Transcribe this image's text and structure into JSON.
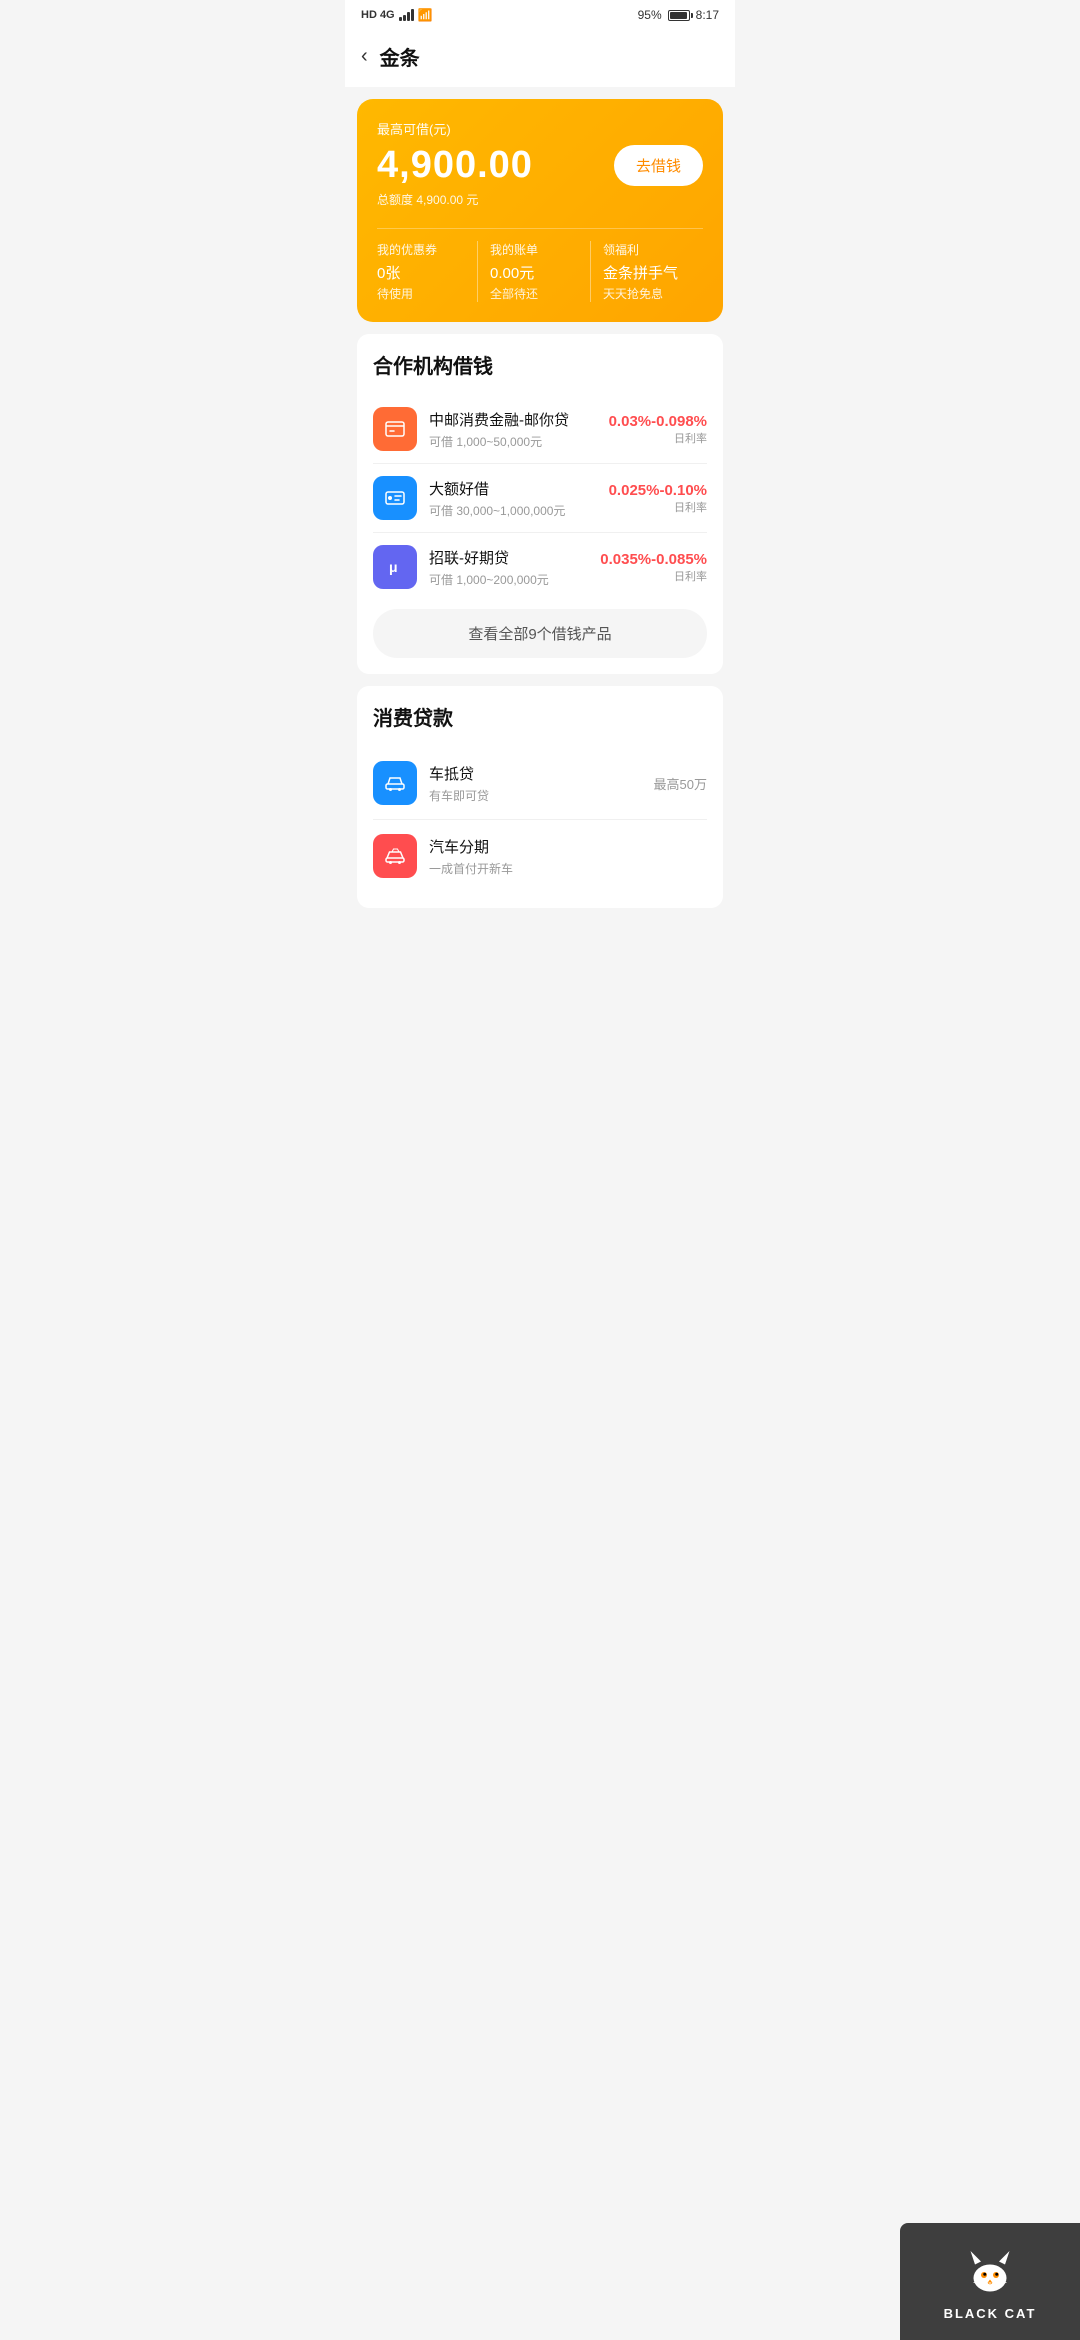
{
  "statusBar": {
    "networkType": "HD 4G",
    "batteryPercent": "95%",
    "time": "8:17"
  },
  "header": {
    "backLabel": "‹",
    "title": "金条"
  },
  "heroCard": {
    "label": "最高可借(元)",
    "amount": "4,900.00",
    "borrowBtnLabel": "去借钱",
    "subLabel": "总额度 4,900.00 元",
    "stats": [
      {
        "title": "我的优惠券",
        "value": "0张",
        "sub": "待使用"
      },
      {
        "title": "我的账单",
        "value": "0.00元",
        "sub": "全部待还"
      },
      {
        "title": "领福利",
        "value": "金条拼手气",
        "sub": "天天抢免息"
      }
    ]
  },
  "partnerSection": {
    "title": "合作机构借钱",
    "loans": [
      {
        "name": "中邮消费金融-邮你贷",
        "range": "可借 1,000~50,000元",
        "rate": "0.03%-0.098%",
        "rateLabel": "日利率",
        "iconColor": "orange",
        "iconText": "📬"
      },
      {
        "name": "大额好借",
        "range": "可借 30,000~1,000,000元",
        "rate": "0.025%-0.10%",
        "rateLabel": "日利率",
        "iconColor": "blue",
        "iconText": "💳"
      },
      {
        "name": "招联-好期贷",
        "range": "可借 1,000~200,000元",
        "rate": "0.035%-0.085%",
        "rateLabel": "日利率",
        "iconColor": "purple",
        "iconText": "μ"
      }
    ],
    "viewAllLabel": "查看全部9个借钱产品"
  },
  "consumerSection": {
    "title": "消费贷款",
    "items": [
      {
        "name": "车抵贷",
        "sub": "有车即可贷",
        "maxLabel": "最高50万",
        "iconColor": "blue",
        "iconText": "🚗"
      },
      {
        "name": "汽车分期",
        "sub": "一成首付开新车",
        "maxLabel": "",
        "iconColor": "red",
        "iconText": "🚘"
      }
    ]
  },
  "blackcat": {
    "text": "BLACK CAT"
  }
}
